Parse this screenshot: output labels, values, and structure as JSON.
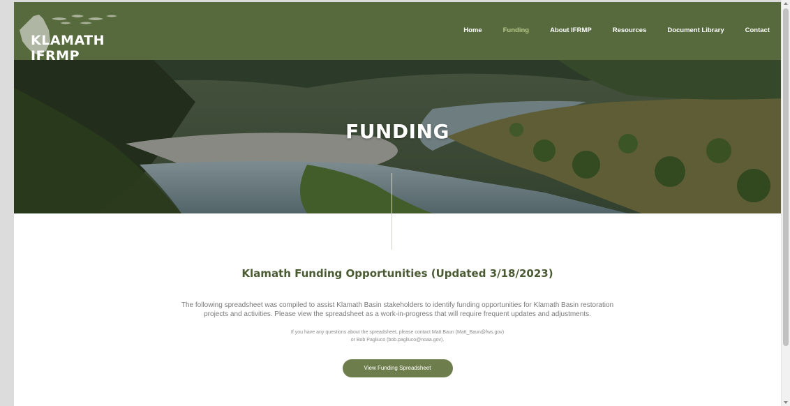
{
  "header": {
    "logo_text": "KLAMATH IFRMP",
    "nav": [
      {
        "label": "Home",
        "active": false
      },
      {
        "label": "Funding",
        "active": true
      },
      {
        "label": "About IFRMP",
        "active": false
      },
      {
        "label": "Resources",
        "active": false
      },
      {
        "label": "Document Library",
        "active": false
      },
      {
        "label": "Contact",
        "active": false
      }
    ]
  },
  "hero": {
    "title": "FUNDING"
  },
  "main": {
    "heading": "Klamath Funding Opportunities (Updated 3/18/2023)",
    "description": "The following spreadsheet was compiled to assist Klamath Basin stakeholders to identify funding opportunities for Klamath Basin restoration projects and activities. Please view the spreadsheet as a work-in-progress that will require frequent updates and adjustments.",
    "contact_line1": "If you have any questions about the spreadsheet, please contact Matt Baun (Matt_Baun@fws.gov)",
    "contact_line2": "or Bob Pagliuco (bob.pagliuco@noaa.gov).",
    "button_label": "View Funding Spreadsheet"
  },
  "colors": {
    "header_bg": "#566a3d",
    "nav_active": "#b8c98a",
    "heading": "#4a5a33",
    "button_bg": "#6e7d4c"
  }
}
